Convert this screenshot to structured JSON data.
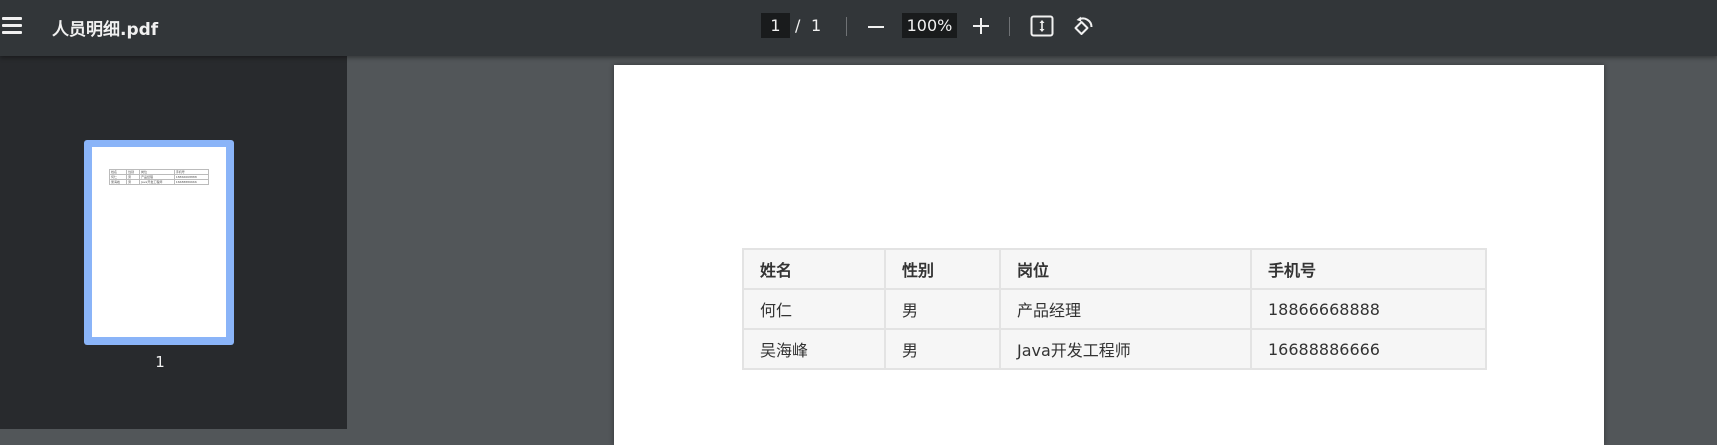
{
  "toolbar": {
    "title": "人员明细.pdf",
    "current_page": "1",
    "separator": "/",
    "total_pages": "1",
    "zoom": "100%"
  },
  "sidebar": {
    "thumbnails": [
      {
        "label": "1"
      }
    ]
  },
  "document": {
    "headers": [
      "姓名",
      "性别",
      "岗位",
      "手机号"
    ],
    "rows": [
      [
        "何仁",
        "男",
        "产品经理",
        "18866668888"
      ],
      [
        "吴海峰",
        "男",
        "Java开发工程师",
        "16688886666"
      ]
    ]
  },
  "colors": {
    "toolbar_bg": "#323639",
    "sidebar_bg": "#282a2d",
    "viewer_bg": "#525659",
    "thumbnail_selected": "#8ab4f8"
  },
  "icons": [
    "menu-icon",
    "zoom-out-icon",
    "zoom-in-icon",
    "fit-to-page-icon",
    "rotate-icon"
  ]
}
